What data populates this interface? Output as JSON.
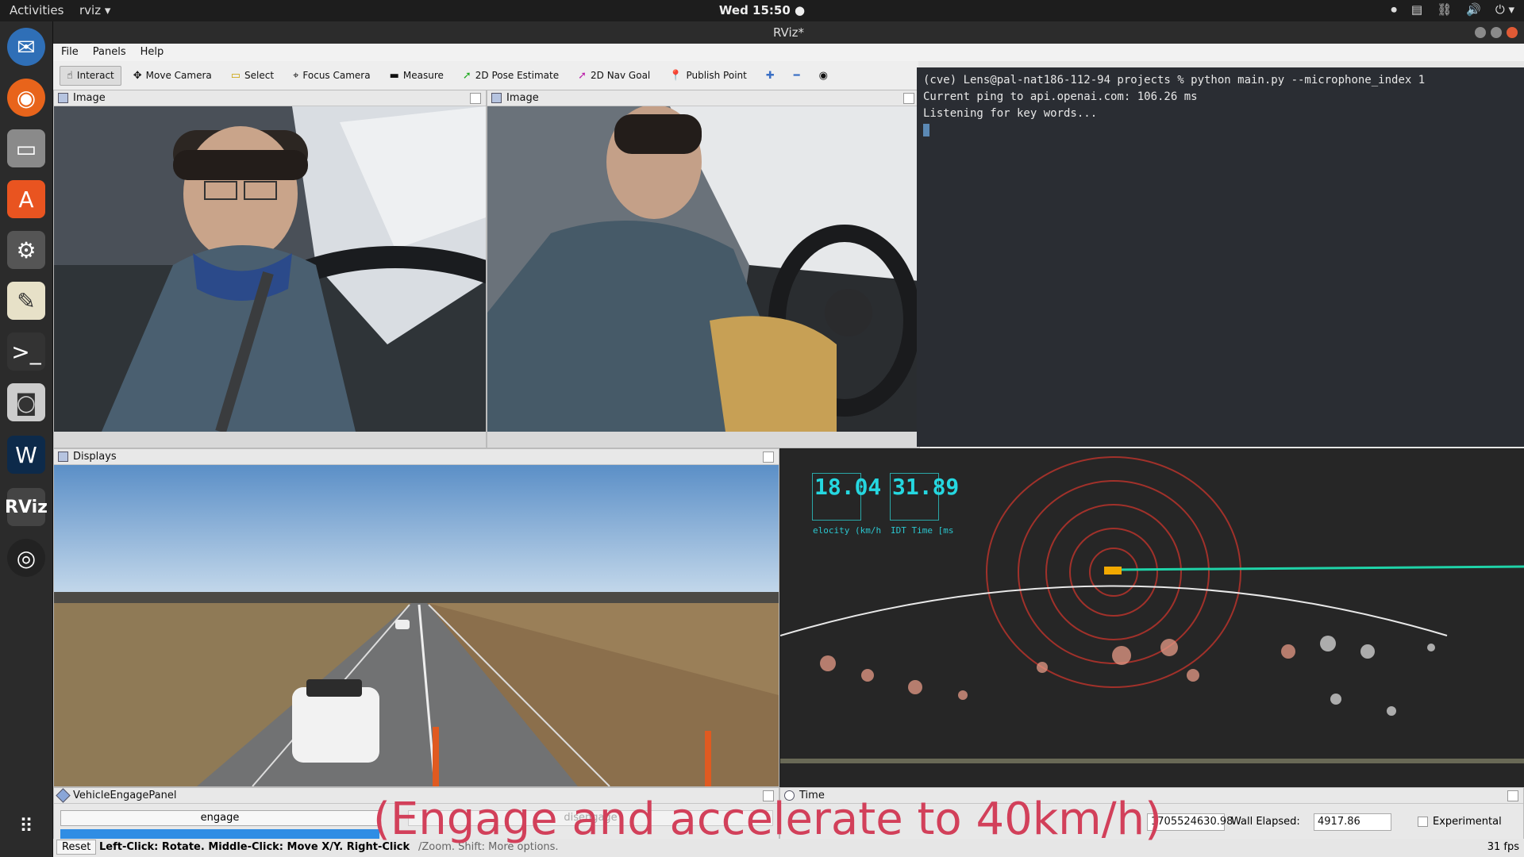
{
  "topbar": {
    "activities": "Activities",
    "app_name": "rviz ▾",
    "clock": "Wed 15:50 ●"
  },
  "window": {
    "title": "RViz*"
  },
  "menu": [
    "File",
    "Panels",
    "Help"
  ],
  "toolbar": {
    "interact": "Interact",
    "move_camera": "Move Camera",
    "select": "Select",
    "focus_camera": "Focus Camera",
    "measure": "Measure",
    "pose_estimate": "2D Pose Estimate",
    "nav_goal": "2D Nav Goal",
    "publish_point": "Publish Point"
  },
  "panels": {
    "image_left": "Image",
    "image_right": "Image",
    "displays": "Displays",
    "engage_panel": "VehicleEngagePanel",
    "time": "Time"
  },
  "terminal": {
    "line1": "(cve) Lens@pal-nat186-112-94 projects % python main.py --microphone_index 1",
    "line2": "Current ping to api.openai.com: 106.26 ms",
    "line3": "Listening for key words..."
  },
  "gauges": {
    "velocity_value": "18.04",
    "velocity_label": "elocity (km/h",
    "idt_value": "31.89",
    "idt_label": "IDT Time [ms"
  },
  "engage": {
    "engage_button": "engage",
    "disengage_button": "disengage",
    "progress": 1.0
  },
  "status": {
    "reset": "Reset",
    "help": "Left-Click: Rotate. Middle-Click: Move X/Y. Right-Click",
    "help_tail": "/Zoom. Shift: More options."
  },
  "time_panel": {
    "ros_time": "1705524630.98",
    "wall_elapsed_label": "Wall Elapsed:",
    "wall_elapsed": "4917.86",
    "experimental": "Experimental",
    "fps": "31 fps"
  },
  "subtitle": "(Engage and accelerate to 40km/h)"
}
